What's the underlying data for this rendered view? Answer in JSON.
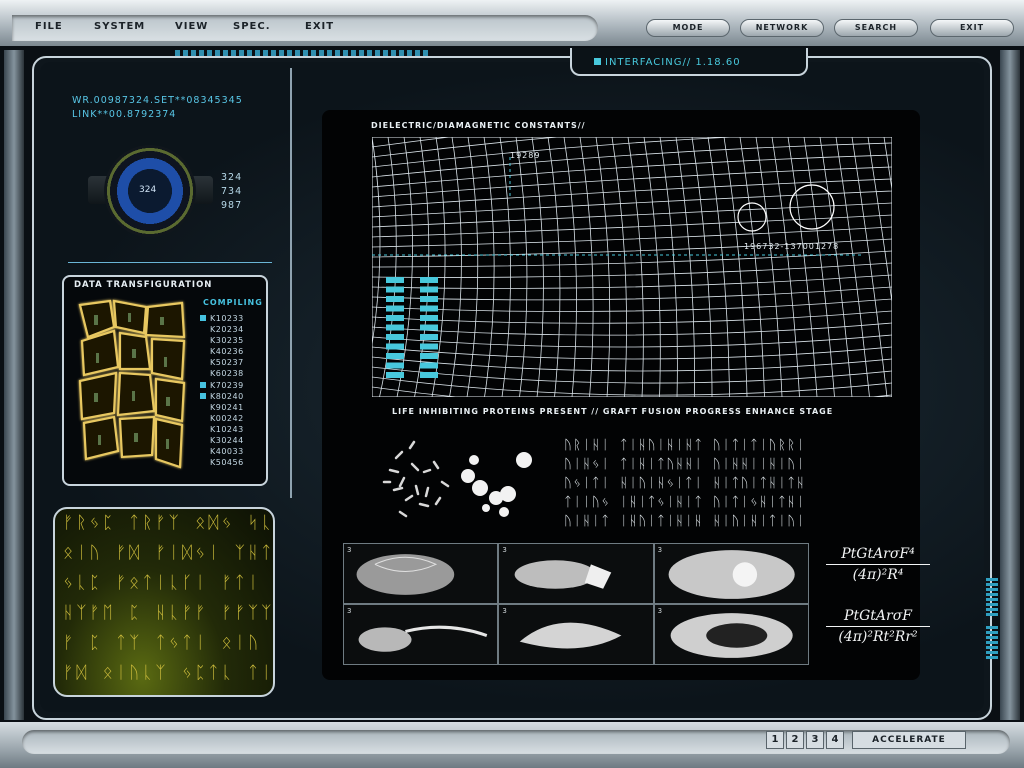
{
  "menu": [
    {
      "label": "FILE"
    },
    {
      "label": "SYSTEM"
    },
    {
      "label": "VIEW"
    },
    {
      "label": "SPEC."
    },
    {
      "label": "EXIT"
    }
  ],
  "top_buttons": [
    {
      "label": "MODE"
    },
    {
      "label": "NETWORK"
    },
    {
      "label": "SEARCH"
    },
    {
      "label": "EXIT"
    }
  ],
  "status": {
    "interfacing": "INTERFACING// 1.18.60"
  },
  "left": {
    "id_line1": "WR.00987324.SET**08345345",
    "id_line2": "LINK**00.8792374",
    "dial_value": "324",
    "readouts": [
      "324",
      "734",
      "987"
    ]
  },
  "transfiguration": {
    "title": "DATA TRANSFIGURATION",
    "status": "COMPILING",
    "codes": [
      {
        "code": "K10233",
        "marked": true
      },
      {
        "code": "K20234",
        "marked": false
      },
      {
        "code": "K30235",
        "marked": false
      },
      {
        "code": "K40236",
        "marked": false
      },
      {
        "code": "K50237",
        "marked": false
      },
      {
        "code": "K60238",
        "marked": false
      },
      {
        "code": "K70239",
        "marked": true
      },
      {
        "code": "K80240",
        "marked": true
      },
      {
        "code": "K90241",
        "marked": false
      },
      {
        "code": "K00242",
        "marked": false
      },
      {
        "code": "K10243",
        "marked": false
      },
      {
        "code": "K30244",
        "marked": false
      },
      {
        "code": "K40033",
        "marked": false
      },
      {
        "code": "K50456",
        "marked": false
      }
    ]
  },
  "glyph_panel": {
    "rows": [
      "ᚠᚱᛃᛈ ᛏᚱᚠᛉ ᛟᛞᛃ ᛋᚳᛉᛏ",
      "ᛟᛁᚢ ᚠᛞ ᚠᛁᛞᛃᛁ ᛉᚺᛏᛃ ᛉ",
      "ᛃᚳᛈ ᚠᛟᛏᛁᚳᚴᛁ ᚠᛏᛁ ᛏ",
      "ᚺᛉᚠᛖ ᛈ ᚺᚳᚠᚠ ᚠᚠᛉᛉ",
      "ᚠ ᛈ ᛏᛉ ᛏᛃᛏᛁ ᛟᛁᚢ ᚠᛞ",
      "ᚠᛞ ᛟᛁᚢᚳᛉ ᛃᛈᛏᚳ ᛏᛁᚢᛏ"
    ]
  },
  "graph": {
    "title": "DIELECTRIC/DIAMAGNETIC CONSTANTS//",
    "label_a": "19289",
    "label_b": "196732-137001278",
    "caption": "LIFE INHIBITING PROTEINS PRESENT // GRAFT FUSION PROGRESS ENHANCE STAGE"
  },
  "alien_text": {
    "rows": [
      "ᚢᚱᛁᚺᛁ ᛏᛁᚺᚢᛁᚺᛁᚺᛏ ᚢᛁᛏᛁᛏᛁᚢᚱᚱᛁ",
      "ᚢᛁᚺᛃᛁ ᛏᛁᚺᛁᛏᚢᚺᚺᛁ ᚢᛁᚺᚺᛁᛁᚺᛁᚢᛁ",
      "ᚢᛃᛁᛏᛁ ᚺᛁᚢᛁᚺᛃᛁᛏᛁ ᚺᛁᛏᚢᛁᛏᚺᛁᛏᚺ",
      "ᛏᛁᛁᚢᛃ ᛁᚺᛁᛏᛃᛁᚺᛁᛏ ᚢᛁᛏᛁᛃᚺᛁᛏᚺᛁ",
      "ᚢᛁᚺᛁᛏ ᛁᚺᚢᛁᛏᛁᚺᛁᚺ ᚺᛁᚢᛁᚺᛁᛏᛁᚢᛁ"
    ]
  },
  "scans": [
    "3",
    "3",
    "3",
    "3",
    "3",
    "3"
  ],
  "formulas": [
    {
      "numerator": "PtGtArσF⁴",
      "denominator": "(4π)²R⁴"
    },
    {
      "numerator": "PtGtArσF",
      "denominator": "(4π)²Rt²Rr²"
    }
  ],
  "bottom": {
    "pages": [
      "1",
      "2",
      "3",
      "4"
    ],
    "accelerate": "ACCELERATE"
  },
  "colors": {
    "accent": "#48c8dc",
    "glyph": "#c8b83a",
    "cell": "#e8c860"
  }
}
